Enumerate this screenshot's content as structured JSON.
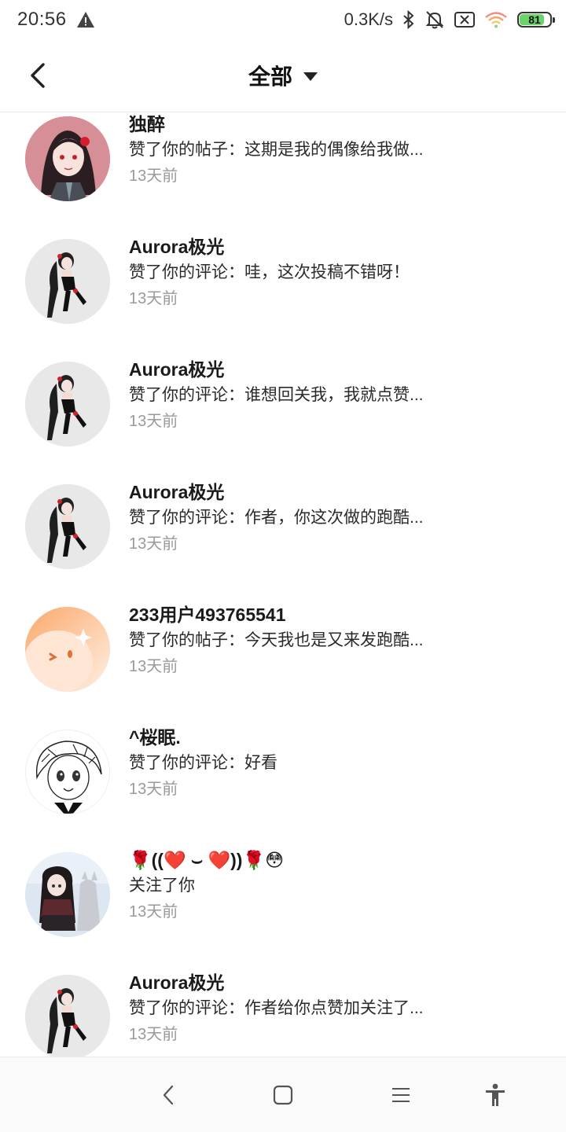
{
  "status_bar": {
    "time": "20:56",
    "net_speed": "0.3K/s",
    "battery_level": "81",
    "icons": [
      "warning-icon",
      "bluetooth-icon",
      "mute-bell-icon",
      "sim-off-icon",
      "wifi-icon",
      "battery-icon"
    ]
  },
  "header": {
    "title": "全部",
    "back_icon": "chevron-left-icon",
    "dropdown_icon": "caret-down-icon"
  },
  "notifications": [
    {
      "name": "独醉",
      "message": "赞了你的帖子：这期是我的偶像给我做...",
      "time": "13天前",
      "avatar": "avatar-girl-red-flower"
    },
    {
      "name": "Aurora极光",
      "message": "赞了你的评论：哇，这次投稿不错呀！",
      "time": "13天前",
      "avatar": "avatar-aurora"
    },
    {
      "name": "Aurora极光",
      "message": "赞了你的评论：谁想回关我，我就点赞...",
      "time": "13天前",
      "avatar": "avatar-aurora"
    },
    {
      "name": "Aurora极光",
      "message": "赞了你的评论：作者，你这次做的跑酷...",
      "time": "13天前",
      "avatar": "avatar-aurora"
    },
    {
      "name": "233用户493765541",
      "message": "赞了你的帖子：今天我也是又来发跑酷...",
      "time": "13天前",
      "avatar": "avatar-orange-default"
    },
    {
      "name": "^桜眠.",
      "message": "赞了你的评论：好看",
      "time": "13天前",
      "avatar": "avatar-manga-girl"
    },
    {
      "name": "🌹((❤️ ⌣ ❤️))🌹😳",
      "message": "关注了你",
      "time": "13天前",
      "avatar": "avatar-girl-with-cat"
    },
    {
      "name": "Aurora极光",
      "message": "赞了你的评论：作者给你点赞加关注了...",
      "time": "13天前",
      "avatar": "avatar-aurora"
    }
  ],
  "nav_bar": {
    "icons": [
      "back-icon",
      "home-square-icon",
      "menu-lines-icon",
      "accessibility-icon"
    ]
  }
}
